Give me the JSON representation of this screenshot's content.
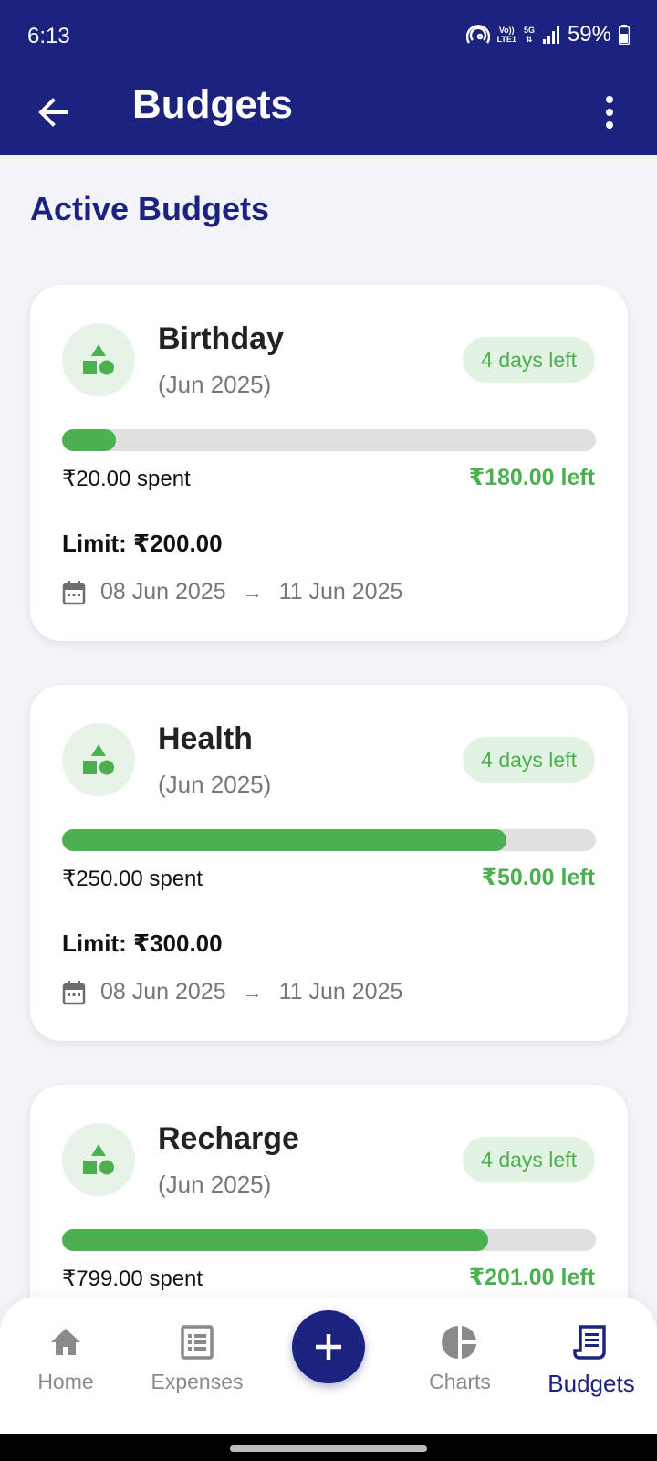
{
  "status_bar": {
    "time": "6:13",
    "network_top": "Vo))",
    "network_bottom": "LTE1",
    "net_type": "5G",
    "battery": "59%"
  },
  "app_bar": {
    "title": "Budgets"
  },
  "section": {
    "title": "Active Budgets"
  },
  "budgets": [
    {
      "name": "Birthday",
      "period": "(Jun 2025)",
      "badge": "4 days left",
      "spent": "₹20.00 spent",
      "left": "₹180.00 left",
      "limit": "Limit: ₹200.00",
      "start": "08 Jun 2025",
      "arrow": "→",
      "end": "11 Jun 2025",
      "progress": 0.1
    },
    {
      "name": "Health",
      "period": "(Jun 2025)",
      "badge": "4 days left",
      "spent": "₹250.00 spent",
      "left": "₹50.00 left",
      "limit": "Limit: ₹300.00",
      "start": "08 Jun 2025",
      "arrow": "→",
      "end": "11 Jun 2025",
      "progress": 0.833
    },
    {
      "name": "Recharge",
      "period": "(Jun 2025)",
      "badge": "4 days left",
      "spent": "₹799.00 spent",
      "left": "₹201.00 left",
      "progress": 0.799
    }
  ],
  "bottom_nav": {
    "items": [
      {
        "label": "Home",
        "icon": "home-icon"
      },
      {
        "label": "Expenses",
        "icon": "list-icon"
      },
      {
        "label": "Charts",
        "icon": "pie-chart-icon"
      },
      {
        "label": "Budgets",
        "icon": "receipt-icon",
        "active": true
      }
    ],
    "fab_icon": "plus-icon"
  },
  "colors": {
    "primary": "#1c237e",
    "accent_green": "#4caf50",
    "badge_bg": "#e3f3e3",
    "background": "#f3f4f8"
  }
}
